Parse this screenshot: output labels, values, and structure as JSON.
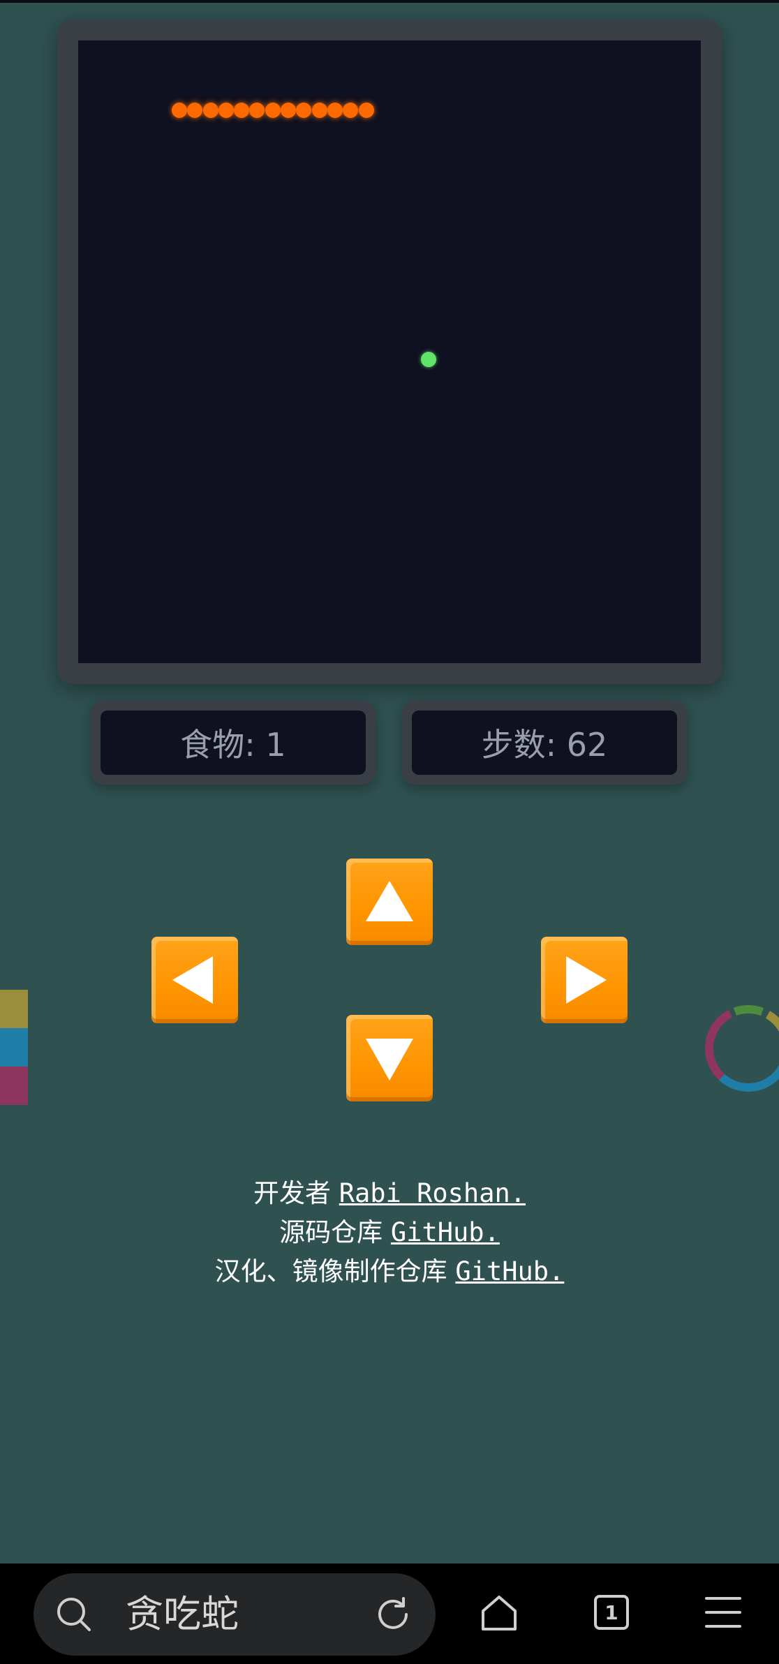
{
  "game": {
    "board": {
      "cols": 40,
      "rows": 40
    },
    "snake": [
      {
        "col": 6,
        "row": 4
      },
      {
        "col": 7,
        "row": 4
      },
      {
        "col": 8,
        "row": 4
      },
      {
        "col": 9,
        "row": 4
      },
      {
        "col": 10,
        "row": 4
      },
      {
        "col": 11,
        "row": 4
      },
      {
        "col": 12,
        "row": 4
      },
      {
        "col": 13,
        "row": 4
      },
      {
        "col": 14,
        "row": 4
      },
      {
        "col": 15,
        "row": 4
      },
      {
        "col": 16,
        "row": 4
      },
      {
        "col": 17,
        "row": 4
      },
      {
        "col": 18,
        "row": 4
      }
    ],
    "food": {
      "col": 22,
      "row": 20
    },
    "colors": {
      "snake": "#ff6a00",
      "food": "#62e46a",
      "board": "#0f1120",
      "frame": "#3a3f46",
      "control": "#ff9500"
    }
  },
  "stats": {
    "food": "食物: 1",
    "steps": "步数: 62"
  },
  "controls": {
    "up_icon": "up-arrow-icon",
    "down_icon": "down-arrow-icon",
    "left_icon": "left-arrow-icon",
    "right_icon": "right-arrow-icon"
  },
  "credits": {
    "line1_prefix": "开发者 ",
    "line1_link": "Rabi Roshan.",
    "line2_prefix": "源码仓库 ",
    "line2_link": "GitHub.",
    "line3_prefix": "汉化、镜像制作仓库 ",
    "line3_link": "GitHub."
  },
  "browser": {
    "search_text": "贪吃蛇",
    "tab_count": "1"
  }
}
